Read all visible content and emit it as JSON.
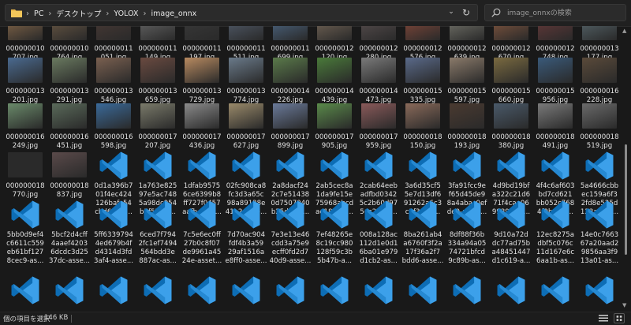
{
  "address_bar": {
    "breadcrumbs": [
      "PC",
      "デスクトップ",
      "YOLOX",
      "image_onnx"
    ],
    "dropdown_glyph": "⌄",
    "refresh_glyph": "↻"
  },
  "search": {
    "placeholder": "image_onnxの検索"
  },
  "files": [
    {
      "l1": "000000010",
      "l2": "707.jpg",
      "kind": "photo",
      "color": "#8a6a4a"
    },
    {
      "l1": "000000010",
      "l2": "764.jpg",
      "kind": "photo",
      "color": "#6d5a45"
    },
    {
      "l1": "000000011",
      "l2": "051.jpg",
      "kind": "photo",
      "color": "#4a3a35"
    },
    {
      "l1": "000000011",
      "l2": "149.jpg",
      "kind": "photo",
      "color": "#6a6a6a"
    },
    {
      "l1": "000000011",
      "l2": "197.jpg",
      "kind": "photo",
      "color": "#3a3a3a"
    },
    {
      "l1": "000000011",
      "l2": "511.jpg",
      "kind": "photo",
      "color": "#556070"
    },
    {
      "l1": "000000011",
      "l2": "699.jpg",
      "kind": "photo",
      "color": "#4f6b8a"
    },
    {
      "l1": "000000012",
      "l2": "120.jpg",
      "kind": "photo",
      "color": "#7a6a5a"
    },
    {
      "l1": "000000012",
      "l2": "280.jpg",
      "kind": "photo",
      "color": "#5a5050"
    },
    {
      "l1": "000000012",
      "l2": "576.jpg",
      "kind": "photo",
      "color": "#8a4a3a"
    },
    {
      "l1": "000000012",
      "l2": "639.jpg",
      "kind": "photo",
      "color": "#7a7a70"
    },
    {
      "l1": "000000012",
      "l2": "670.jpg",
      "kind": "photo",
      "color": "#8a5a40"
    },
    {
      "l1": "000000012",
      "l2": "748.jpg",
      "kind": "photo",
      "color": "#6a3a3a"
    },
    {
      "l1": "000000013",
      "l2": "177.jpg",
      "kind": "photo",
      "color": "#5a6a70"
    },
    {
      "l1": "000000013",
      "l2": "201.jpg",
      "kind": "photo",
      "color": "#4a6a90"
    },
    {
      "l1": "000000013",
      "l2": "291.jpg",
      "kind": "photo",
      "color": "#6a7a60"
    },
    {
      "l1": "000000013",
      "l2": "546.jpg",
      "kind": "photo",
      "color": "#7a6050"
    },
    {
      "l1": "000000013",
      "l2": "659.jpg",
      "kind": "photo",
      "color": "#6a4a40"
    },
    {
      "l1": "000000013",
      "l2": "729.jpg",
      "kind": "photo",
      "color": "#b88a60"
    },
    {
      "l1": "000000013",
      "l2": "774.jpg",
      "kind": "photo",
      "color": "#6a7a8a"
    },
    {
      "l1": "000000014",
      "l2": "226.jpg",
      "kind": "photo",
      "color": "#5a7a4a"
    },
    {
      "l1": "000000014",
      "l2": "439.jpg",
      "kind": "photo",
      "color": "#4a7a3a"
    },
    {
      "l1": "000000014",
      "l2": "473.jpg",
      "kind": "photo",
      "color": "#7a7a7a"
    },
    {
      "l1": "000000015",
      "l2": "335.jpg",
      "kind": "photo",
      "color": "#5a6a8a"
    },
    {
      "l1": "000000015",
      "l2": "597.jpg",
      "kind": "photo",
      "color": "#8a7a6a"
    },
    {
      "l1": "000000015",
      "l2": "660.jpg",
      "kind": "photo",
      "color": "#7a6a40"
    },
    {
      "l1": "000000015",
      "l2": "956.jpg",
      "kind": "photo",
      "color": "#3a5a7a"
    },
    {
      "l1": "000000016",
      "l2": "228.jpg",
      "kind": "photo",
      "color": "#5a4a3a"
    },
    {
      "l1": "000000016",
      "l2": "249.jpg",
      "kind": "photo",
      "color": "#6a8a6a"
    },
    {
      "l1": "000000016",
      "l2": "451.jpg",
      "kind": "photo",
      "color": "#5a6a5a"
    },
    {
      "l1": "000000016",
      "l2": "598.jpg",
      "kind": "photo",
      "color": "#3a6a9a"
    },
    {
      "l1": "000000017",
      "l2": "207.jpg",
      "kind": "photo",
      "color": "#7a7a6a"
    },
    {
      "l1": "000000017",
      "l2": "436.jpg",
      "kind": "photo",
      "color": "#8a8a8a"
    },
    {
      "l1": "000000017",
      "l2": "627.jpg",
      "kind": "photo",
      "color": "#9a8a6a"
    },
    {
      "l1": "000000017",
      "l2": "899.jpg",
      "kind": "photo",
      "color": "#6a7a9a"
    },
    {
      "l1": "000000017",
      "l2": "905.jpg",
      "kind": "photo",
      "color": "#5a8a4a"
    },
    {
      "l1": "000000017",
      "l2": "959.jpg",
      "kind": "photo",
      "color": "#8a5a5a"
    },
    {
      "l1": "000000018",
      "l2": "150.jpg",
      "kind": "photo",
      "color": "#8a6a5a"
    },
    {
      "l1": "000000018",
      "l2": "193.jpg",
      "kind": "photo",
      "color": "#4a3a30"
    },
    {
      "l1": "000000018",
      "l2": "380.jpg",
      "kind": "photo",
      "color": "#4a5a6a"
    },
    {
      "l1": "000000018",
      "l2": "491.jpg",
      "kind": "photo",
      "color": "#7a7a7a"
    },
    {
      "l1": "000000018",
      "l2": "519.jpg",
      "kind": "photo",
      "color": "#6a6a6a"
    },
    {
      "l1": "000000018",
      "l2": "770.jpg",
      "kind": "photo",
      "color": "#2a2a2a"
    },
    {
      "l1": "000000018",
      "l2": "837.jpg",
      "kind": "photo",
      "color": "#5a4a4a"
    },
    {
      "l1": "0d1a396b7",
      "l2": "01f4ec424",
      "l3": "126bafc54",
      "l4": "cbd64-as...",
      "kind": "vs"
    },
    {
      "l1": "1a763e825",
      "l2": "97e5ac748",
      "l3": "5a98dc954",
      "l4": "b5f57-as...",
      "kind": "vs"
    },
    {
      "l1": "1dfab9575",
      "l2": "6ce6399b8",
      "l3": "ff727f0457",
      "l4": "aafb-asse...",
      "kind": "vs"
    },
    {
      "l1": "02fc908ca8",
      "l2": "fc3d3a65c",
      "l3": "98a89138e",
      "l4": "41a2-asse...",
      "kind": "vs"
    },
    {
      "l1": "2a8dacf24",
      "l2": "2c7e51438",
      "l3": "0d7507040",
      "l4": "b25d3-as...",
      "kind": "vs"
    },
    {
      "l1": "2ab5cec8a",
      "l2": "1da9fe15e",
      "l3": "75968abcd",
      "l4": "ae185-as...",
      "kind": "vs"
    },
    {
      "l1": "2cab64eeb",
      "l2": "adfbd0342",
      "l3": "5c2b60d97",
      "l4": "5ec21-as...",
      "kind": "vs"
    },
    {
      "l1": "3a6d35cf5",
      "l2": "5e7d13df6",
      "l3": "91262a6c3",
      "l4": "c3f3c-as...",
      "kind": "vs"
    },
    {
      "l1": "3fa91fcc9e",
      "l2": "f65d45de9",
      "l3": "8a4abac0ef",
      "l4": "de0-asset...",
      "kind": "vs"
    },
    {
      "l1": "4d9bd19bf",
      "l2": "a322c21d6",
      "l3": "71f4caa06",
      "l4": "9939a-as...",
      "kind": "vs"
    },
    {
      "l1": "4f4c6af603",
      "l2": "bd7cd621",
      "l3": "bb052c768",
      "l4": "4f9b0-as...",
      "kind": "vs"
    },
    {
      "l1": "5a4666cbb",
      "l2": "ec159a6f3",
      "l3": "2fd8e525d",
      "l4": "123a6-as...",
      "kind": "vs"
    },
    {
      "l1": "5bb0d9ef4",
      "l2": "c6611c559",
      "l3": "eb61bf127",
      "l4": "8cec9-as...",
      "kind": "vs"
    },
    {
      "l1": "5bcf2d4cff",
      "l2": "4aaef4203",
      "l3": "6dcdc3d25",
      "l4": "37dc-asse...",
      "kind": "vs"
    },
    {
      "l1": "5ff6339794",
      "l2": "4ed679b4f",
      "l3": "d4314d3fd",
      "l4": "3af4-asse...",
      "kind": "vs"
    },
    {
      "l1": "6ced7f794",
      "l2": "2fc1ef7494",
      "l3": "564bdd3e",
      "l4": "887ac-as...",
      "kind": "vs"
    },
    {
      "l1": "7c5e6ec0ff",
      "l2": "27b0c8f07",
      "l3": "de9961a45",
      "l4": "24e-asset...",
      "kind": "vs"
    },
    {
      "l1": "7d70ac904",
      "l2": "fdf4b3a59",
      "l3": "29af1516a",
      "l4": "e8ff0-asse...",
      "kind": "vs"
    },
    {
      "l1": "7e3e13e46",
      "l2": "cdd3a75e9",
      "l3": "ecff0fd2d7",
      "l4": "40d9-asse...",
      "kind": "vs"
    },
    {
      "l1": "7ef48265e",
      "l2": "8c19cc980",
      "l3": "128f59c3b",
      "l4": "5b47b-a...",
      "kind": "vs"
    },
    {
      "l1": "008a128ac",
      "l2": "112d1e0d1",
      "l3": "6ba01e979",
      "l4": "d1cb2-as...",
      "kind": "vs"
    },
    {
      "l1": "8ba261ab4",
      "l2": "a6760f3f2a",
      "l3": "17f36a2f7",
      "l4": "bdd6-asse...",
      "kind": "vs"
    },
    {
      "l1": "8df88f36b",
      "l2": "334a94a05",
      "l3": "74721bfcd",
      "l4": "9c89b-as...",
      "kind": "vs"
    },
    {
      "l1": "9d10a72d",
      "l2": "dc77ad75b",
      "l3": "a48451447",
      "l4": "d1c619-a...",
      "kind": "vs"
    },
    {
      "l1": "12ec8275a",
      "l2": "dbf5c076c",
      "l3": "11d167e6c",
      "l4": "6aa1b-as...",
      "kind": "vs"
    },
    {
      "l1": "14e0c7663",
      "l2": "67a20aad2",
      "l3": "9856aa3f9",
      "l4": "13a01-as...",
      "kind": "vs"
    },
    {
      "kind": "vs"
    },
    {
      "kind": "vs"
    },
    {
      "kind": "vs"
    },
    {
      "kind": "vs"
    },
    {
      "kind": "vs"
    },
    {
      "kind": "vs"
    },
    {
      "kind": "vs"
    },
    {
      "kind": "vs"
    },
    {
      "kind": "vs"
    },
    {
      "kind": "vs"
    },
    {
      "kind": "vs"
    },
    {
      "kind": "vs"
    },
    {
      "kind": "vs"
    },
    {
      "kind": "vs"
    }
  ],
  "status": {
    "selection": "個の項目を選択",
    "size": "146 KB"
  },
  "colors": {
    "vs_light": "#3ca0ea",
    "vs_dark": "#0d6db5",
    "folder": "#e8b64a"
  }
}
